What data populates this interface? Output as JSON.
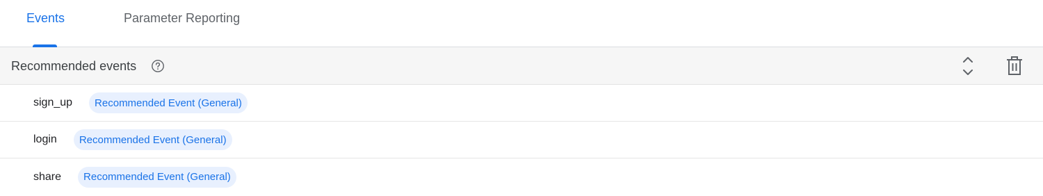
{
  "tabs": [
    {
      "label": "Events",
      "active": true
    },
    {
      "label": "Parameter Reporting",
      "active": false
    }
  ],
  "section": {
    "title": "Recommended events"
  },
  "events": [
    {
      "name": "sign_up",
      "chip": "Recommended Event (General)"
    },
    {
      "name": "login",
      "chip": "Recommended Event (General)"
    },
    {
      "name": "share",
      "chip": "Recommended Event (General)"
    }
  ],
  "icons": {
    "help": "help-circle-icon",
    "expand": "unfold-more-icon",
    "delete": "trash-icon"
  },
  "colors": {
    "accent": "#1a73e8",
    "chip_bg": "#e8f0fe",
    "header_bg": "#f6f6f6"
  }
}
